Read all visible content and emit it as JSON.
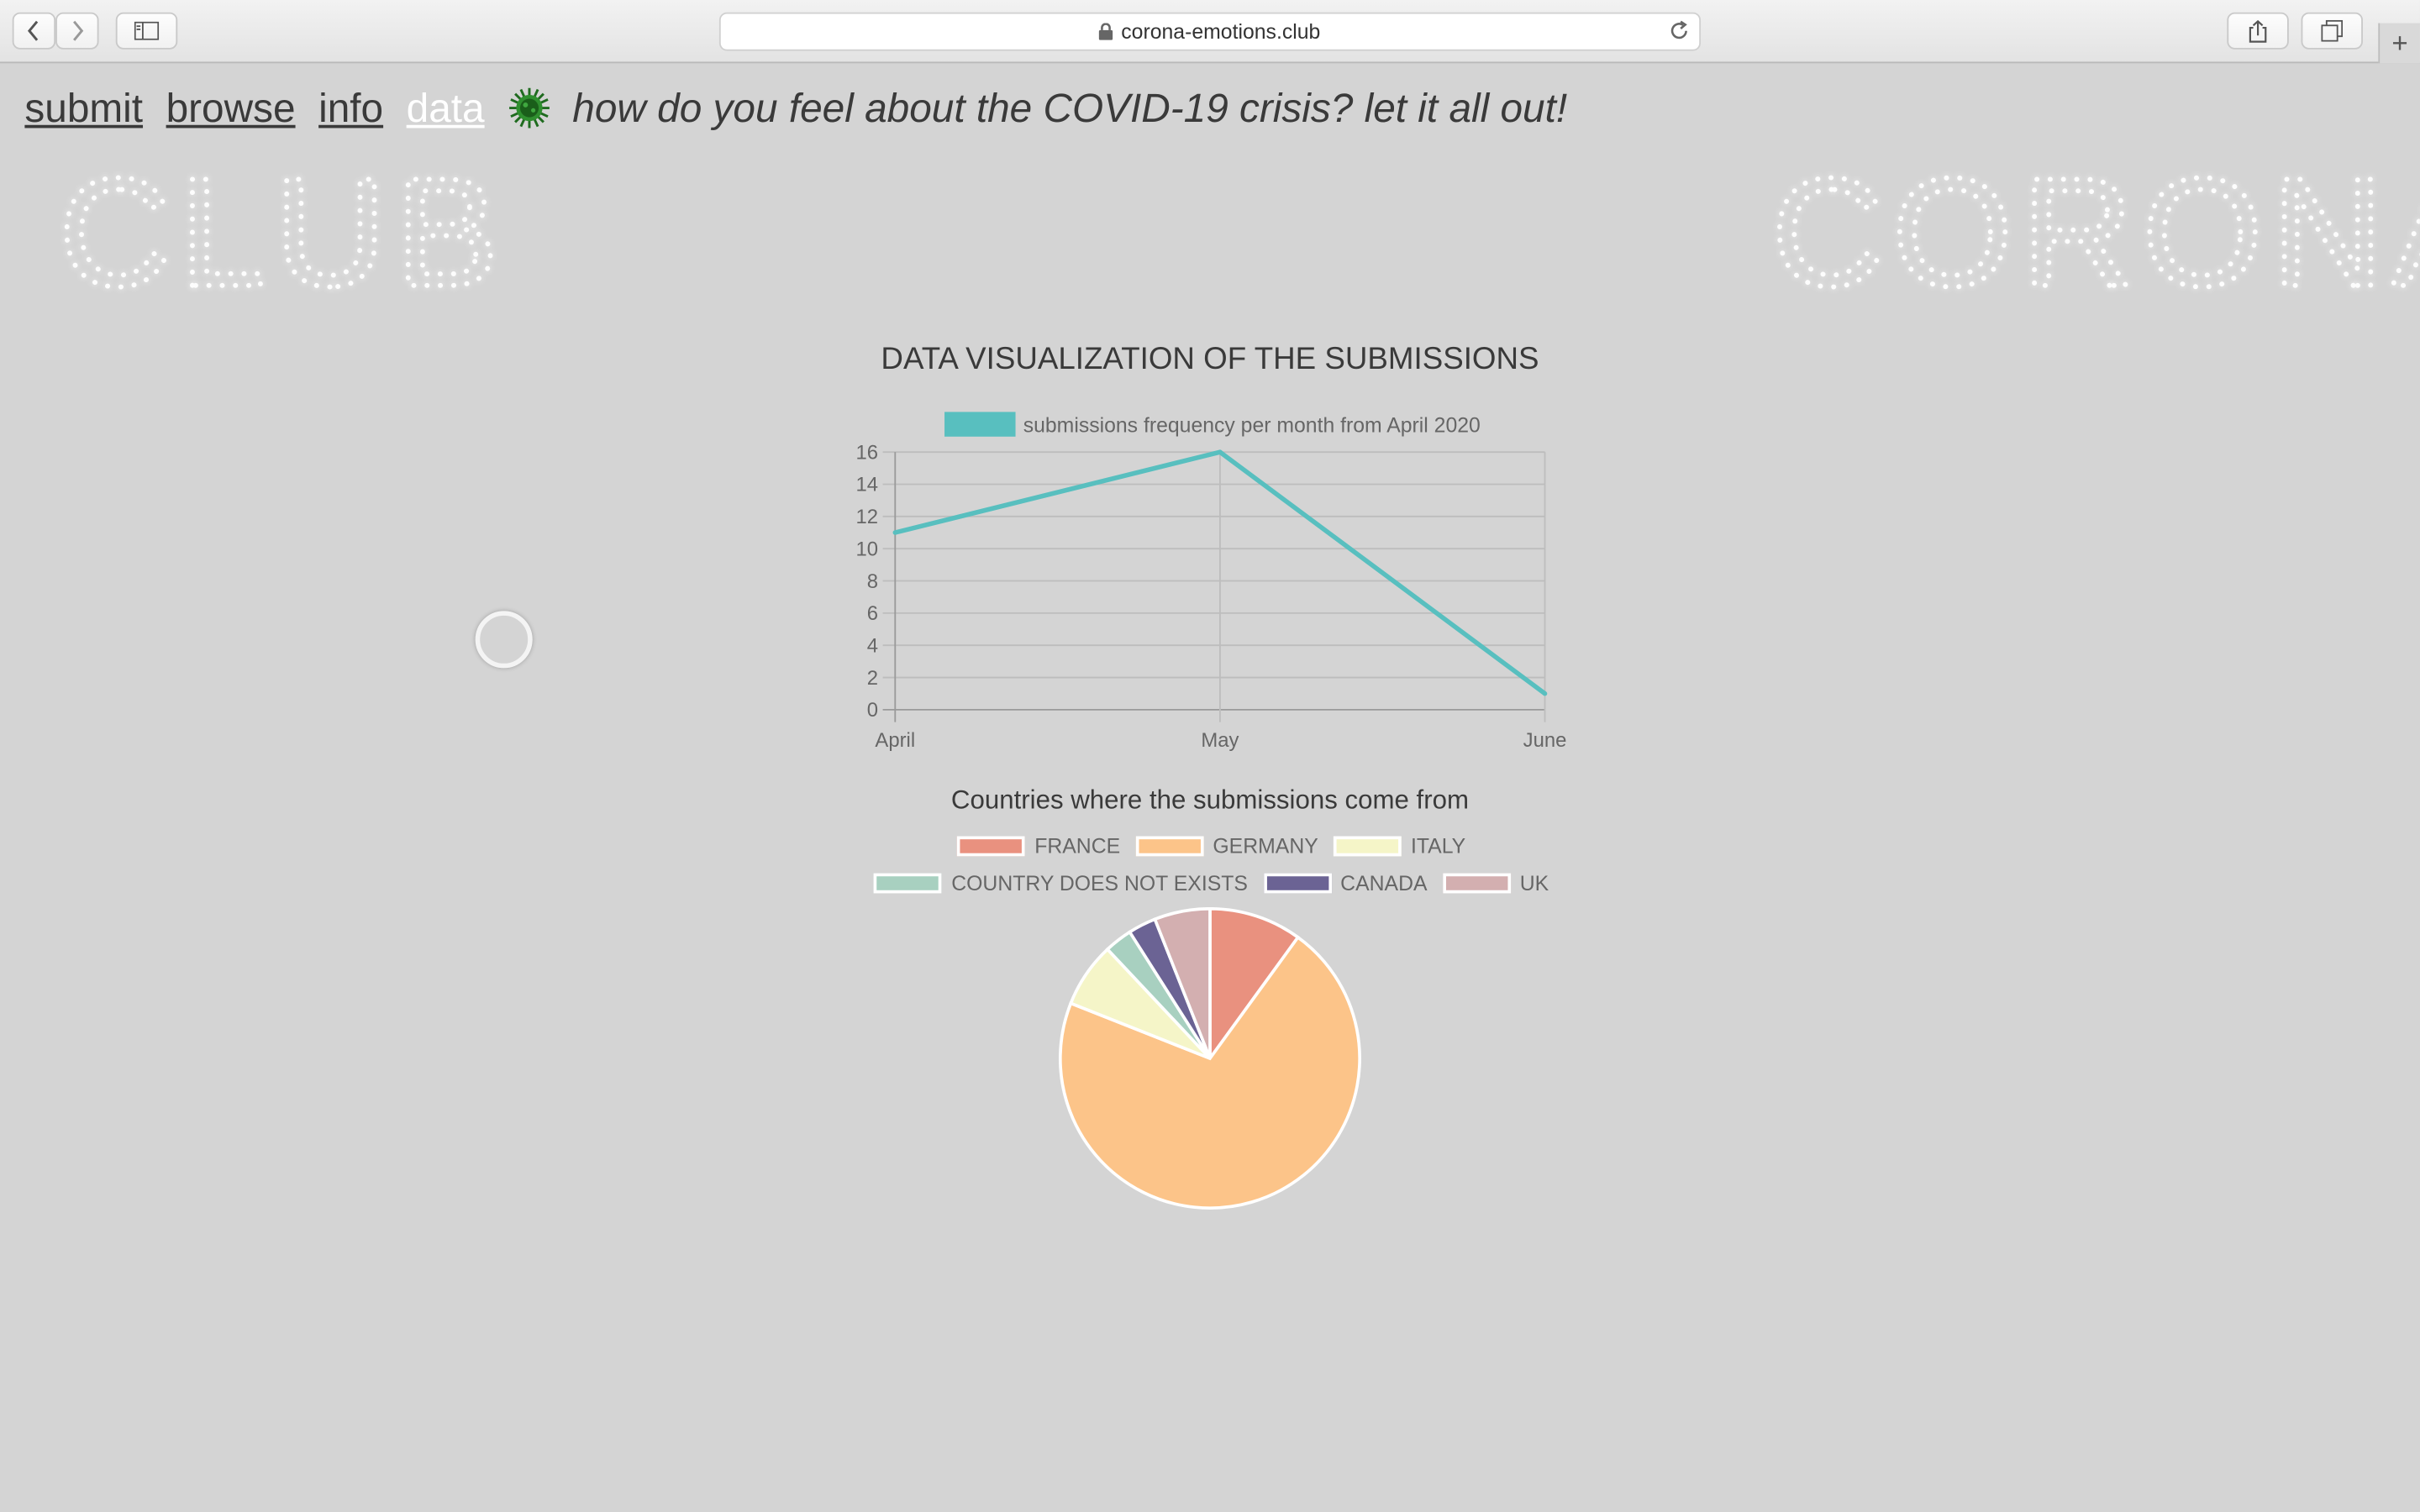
{
  "browser": {
    "url": "corona-emotions.club"
  },
  "nav": {
    "links": [
      "submit",
      "browse",
      "info",
      "data"
    ],
    "active": "data",
    "tagline": "how do you feel about the COVID-19 crisis? let it all out!"
  },
  "marquee": {
    "text": "CORONA EMOTIONS CLUB"
  },
  "page": {
    "title": "DATA VISUALIZATION OF THE SUBMISSIONS"
  },
  "chart_data": [
    {
      "type": "line",
      "title": "",
      "categories": [
        "April",
        "May",
        "June"
      ],
      "series": [
        {
          "name": "submissions frequency per month from April 2020",
          "values": [
            11,
            16,
            1
          ],
          "color": "#58bfbf"
        }
      ],
      "ylim": [
        0,
        16
      ],
      "yticks": [
        0,
        2,
        4,
        6,
        8,
        10,
        12,
        14,
        16
      ],
      "grid": true,
      "legend": "top"
    },
    {
      "type": "pie",
      "title": "Countries where the submissions come from",
      "labels": [
        "FRANCE",
        "GERMANY",
        "ITALY",
        "COUNTRY DOES NOT EXISTS",
        "CANADA",
        "UK"
      ],
      "values": [
        10,
        71,
        7,
        3,
        3,
        6
      ],
      "colors": [
        "#e9917f",
        "#fcc489",
        "#f5f5c8",
        "#a8d0c0",
        "#6b6394",
        "#d3afb0"
      ],
      "legend": "top"
    }
  ]
}
